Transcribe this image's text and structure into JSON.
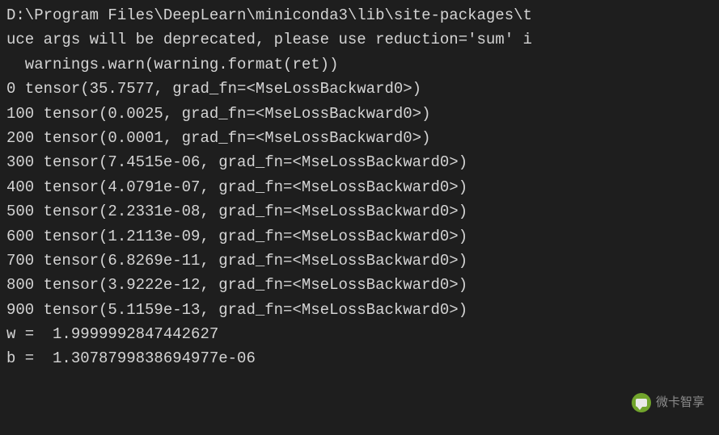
{
  "lines": [
    "D:\\Program Files\\DeepLearn\\miniconda3\\lib\\site-packages\\t",
    "uce args will be deprecated, please use reduction='sum' i",
    "  warnings.warn(warning.format(ret))",
    "0 tensor(35.7577, grad_fn=<MseLossBackward0>)",
    "100 tensor(0.0025, grad_fn=<MseLossBackward0>)",
    "200 tensor(0.0001, grad_fn=<MseLossBackward0>)",
    "300 tensor(7.4515e-06, grad_fn=<MseLossBackward0>)",
    "400 tensor(4.0791e-07, grad_fn=<MseLossBackward0>)",
    "500 tensor(2.2331e-08, grad_fn=<MseLossBackward0>)",
    "600 tensor(1.2113e-09, grad_fn=<MseLossBackward0>)",
    "700 tensor(6.8269e-11, grad_fn=<MseLossBackward0>)",
    "800 tensor(3.9222e-12, grad_fn=<MseLossBackward0>)",
    "900 tensor(5.1159e-13, grad_fn=<MseLossBackward0>)",
    "w =  1.9999992847442627",
    "b =  1.3078799838694977e-06"
  ],
  "watermark": {
    "text": "微卡智享"
  }
}
